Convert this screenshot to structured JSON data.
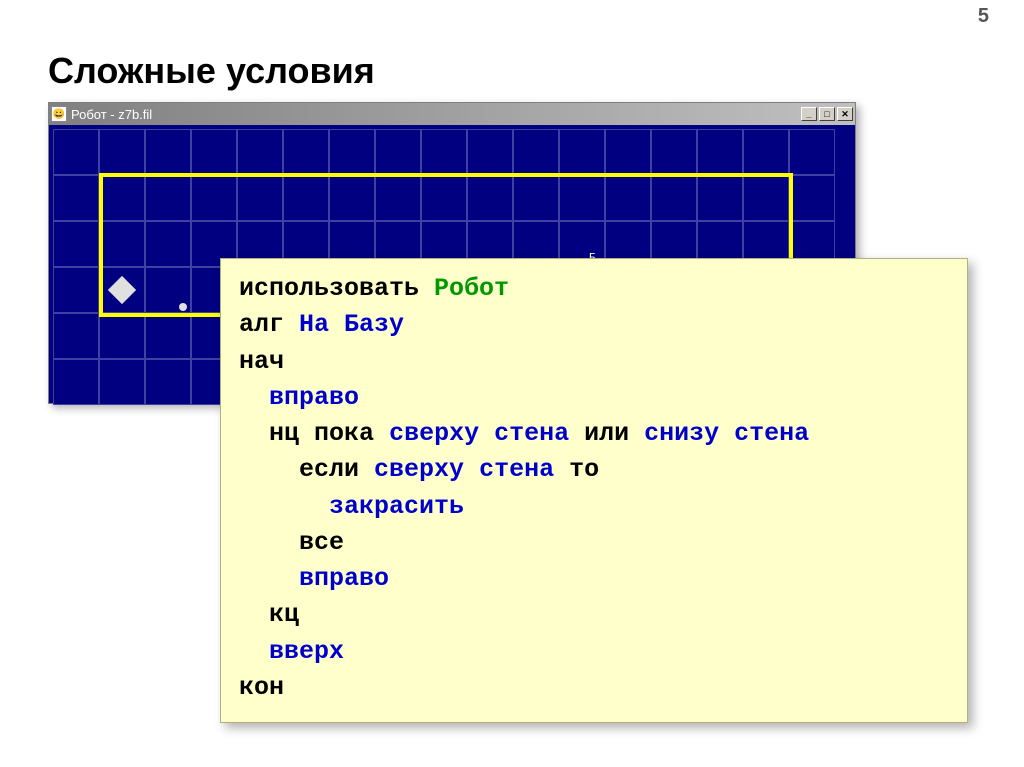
{
  "page_number": "5",
  "slide_title": "Сложные условия",
  "window": {
    "title": "Робот - z7b.fil",
    "icon": "😀"
  },
  "base_marker": "Б",
  "code": {
    "l1_use": "использовать",
    "l1_robot": "Робот",
    "l2_alg": "алг",
    "l2_name": "На Базу",
    "l3": "нач",
    "l4": "вправо",
    "l5_nc": "нц",
    "l5_while": "пока",
    "l5_c1": "сверху стена",
    "l5_or": "или",
    "l5_c2": "снизу стена",
    "l6_if": "если",
    "l6_cond": "сверху стена",
    "l6_then": "то",
    "l7": "закрасить",
    "l8": "все",
    "l9": "вправо",
    "l10": "кц",
    "l11": "вверх",
    "l12": "кон"
  }
}
